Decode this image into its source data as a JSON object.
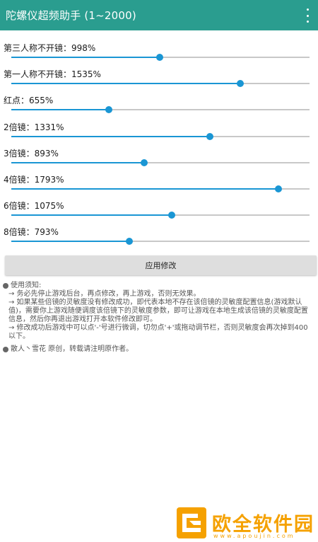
{
  "app": {
    "title": "陀螺仪超频助手 (1~2000)"
  },
  "colors": {
    "appbar": "#2a9d8f",
    "accent": "#1a96d4",
    "track": "#c8c8c8",
    "button": "#dedede",
    "watermark": "#f5a100"
  },
  "sliders": [
    {
      "label": "第三人称不开镜：998%",
      "value": 998
    },
    {
      "label": "第一人称不开镜：1535%",
      "value": 1535
    },
    {
      "label": "红点：655%",
      "value": 655
    },
    {
      "label": "2倍镜：1331%",
      "value": 1331
    },
    {
      "label": "3倍镜：893%",
      "value": 893
    },
    {
      "label": "4倍镜：1793%",
      "value": 1793
    },
    {
      "label": "6倍镜：1075%",
      "value": 1075
    },
    {
      "label": "8倍镜：793%",
      "value": 793
    }
  ],
  "slider_range": [
    1,
    2000
  ],
  "apply_button": "应用修改",
  "notes": {
    "heading": "使用须知:",
    "lines": [
      "→ 务必先停止游戏后台，再点修改，再上游戏，否则无效果。",
      "→ 如果某些倍镜的灵敏度没有修改成功，即代表本地不存在该倍镜的灵敏度配置信息(游戏默认值)，需要你上游戏随便调度该倍镜下的灵敏度参数，即可让游戏在本地生成该倍镜的灵敏度配置信息，然后你再退出游戏打开本软件修改即可。",
      "→ 修改成功后游戏中可以点'-'号进行微调，切勿点'+'或拖动调节栏，否则灵敏度会再次掉到400以下。"
    ],
    "author": "散人丶雪花 原创，转载请注明原作者。"
  },
  "watermark": {
    "text": "欧全软件园",
    "url": "www.apoujin.com"
  }
}
